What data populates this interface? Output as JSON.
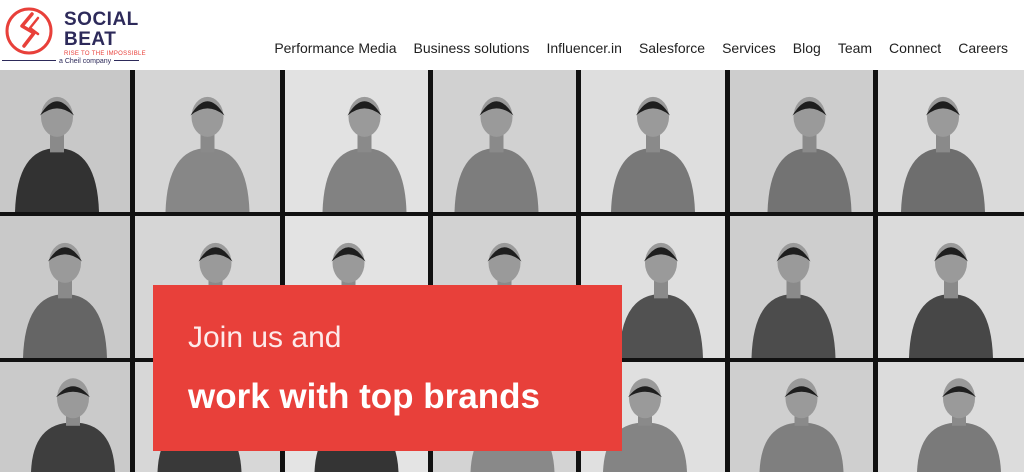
{
  "brand": {
    "name_line1": "SOCIAL",
    "name_line2": "BEAT",
    "tagline": "RISE TO THE IMPOSSIBLE",
    "company": "a Cheil company",
    "accent": "#e8403a",
    "navy": "#2d2a5a"
  },
  "nav": {
    "items": [
      "Performance Media",
      "Business solutions",
      "Influencer.in",
      "Salesforce",
      "Services",
      "Blog",
      "Team",
      "Connect",
      "Careers"
    ]
  },
  "hero": {
    "line1": "Join us and",
    "line2": "work with top brands",
    "background": "#e8403a"
  }
}
